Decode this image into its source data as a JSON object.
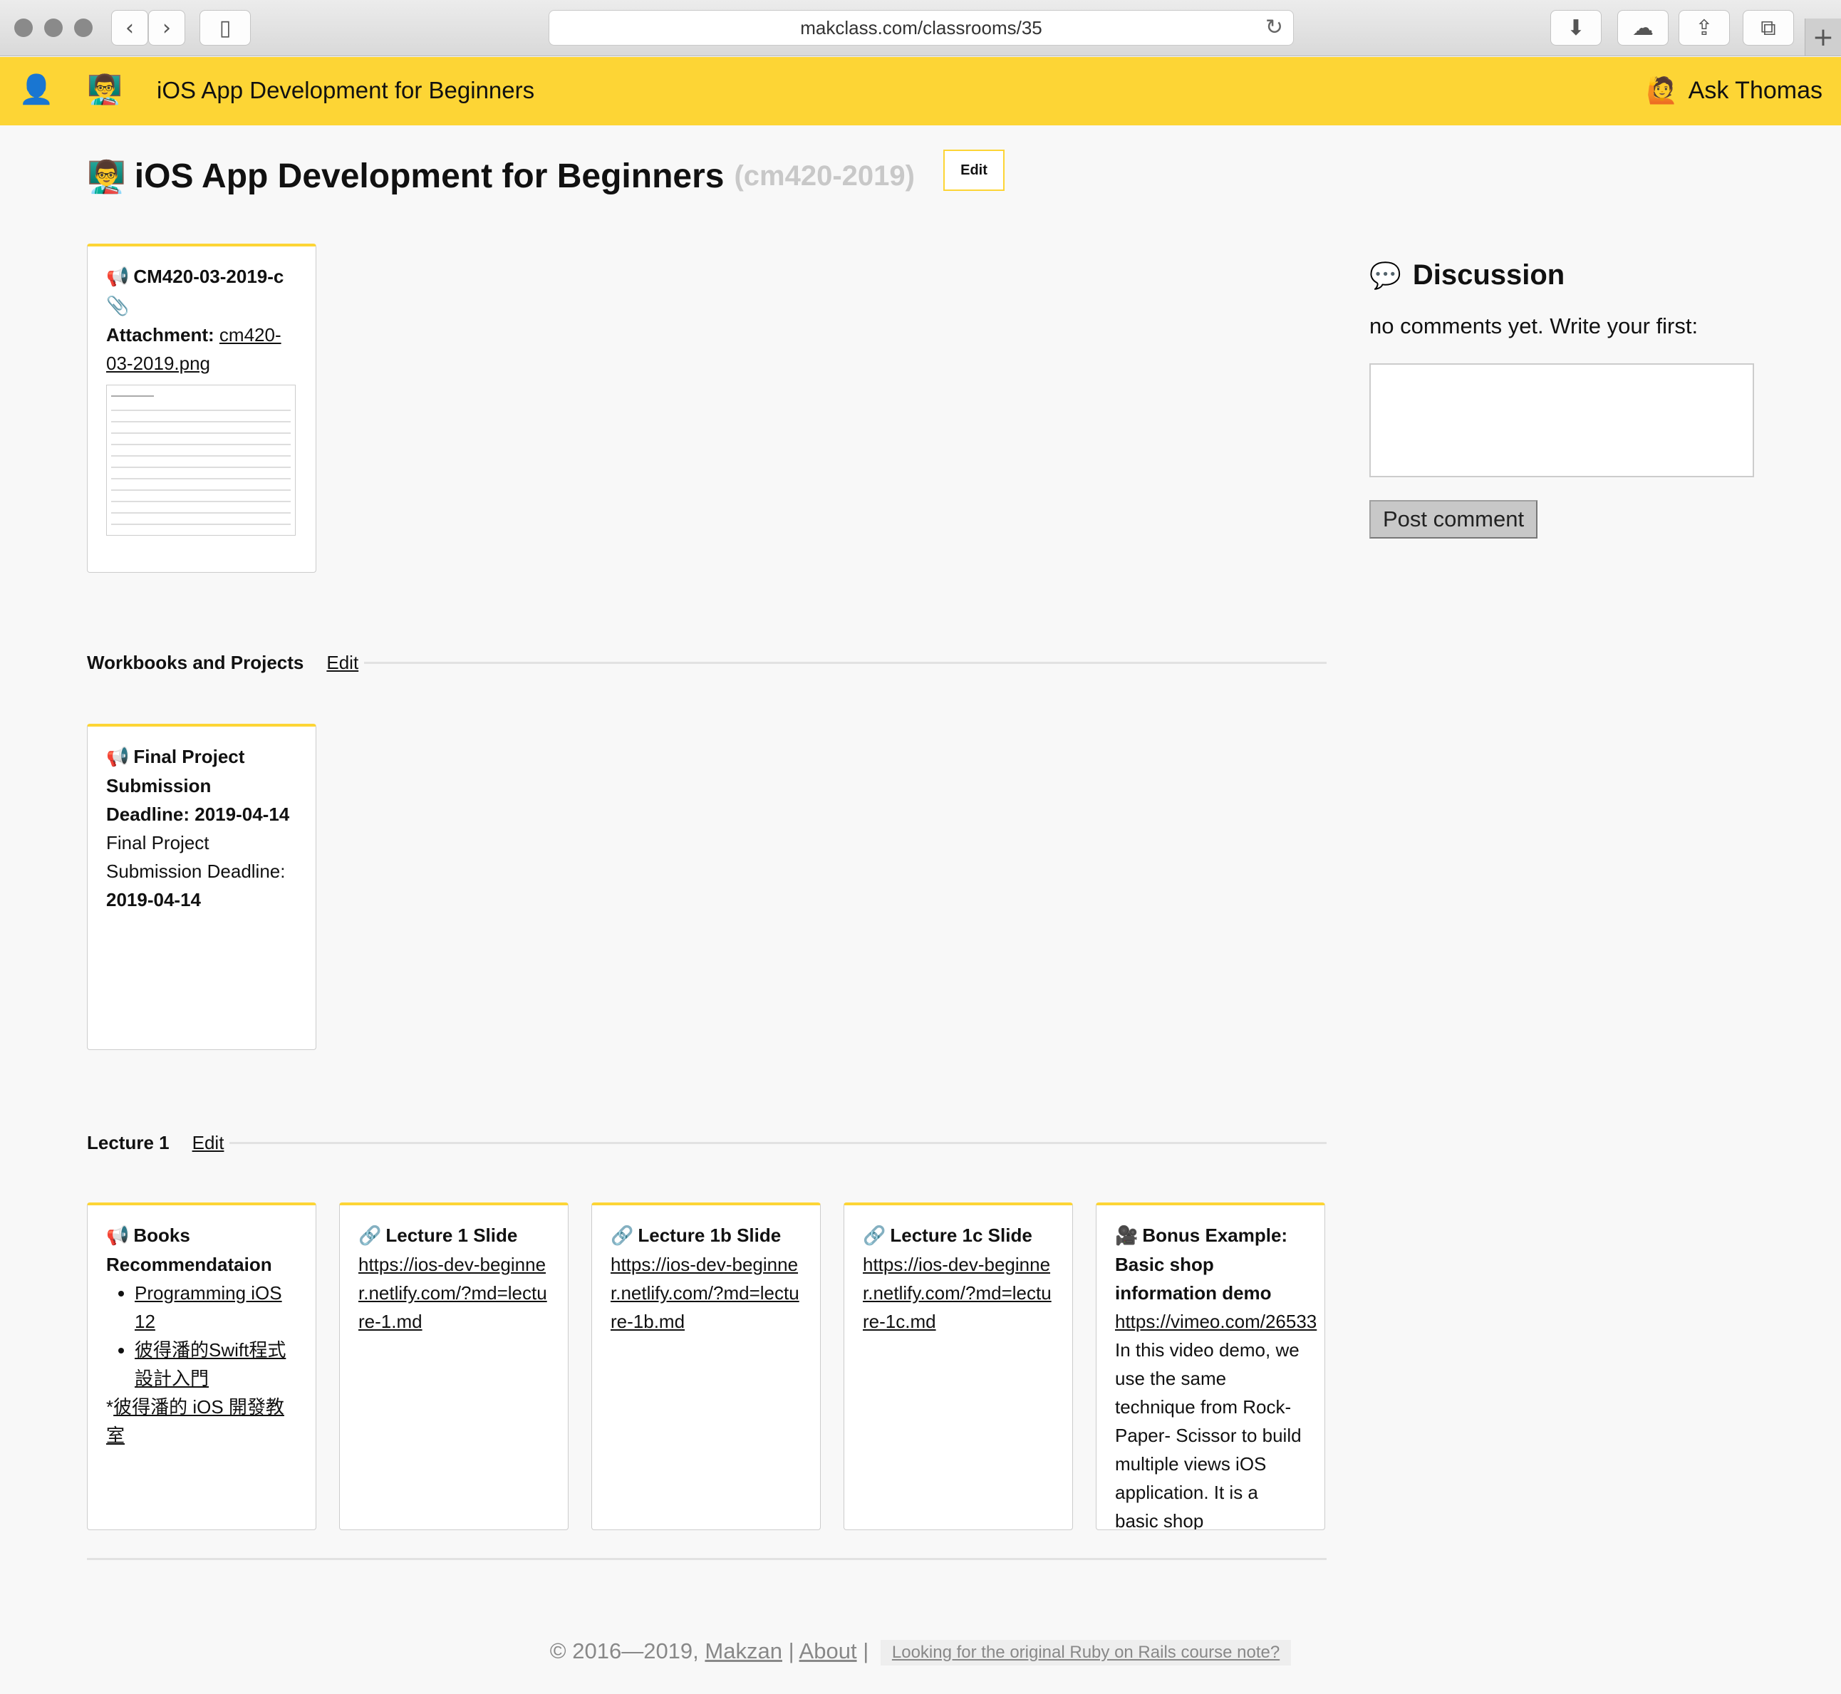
{
  "browser": {
    "url": "makclass.com/classrooms/35",
    "icons": [
      "traffic-lights",
      "back-icon",
      "forward-icon",
      "sidebar-icon",
      "reload-icon",
      "download-icon",
      "account-icon",
      "share-icon",
      "tabs-icon",
      "new-tab-icon"
    ]
  },
  "header": {
    "site_title": "iOS App Development for Beginners",
    "ask_label": "Ask Thomas",
    "brand_color": "#fdd535"
  },
  "page": {
    "title": "iOS App Development for Beginners",
    "code": "(cm420-2019)",
    "edit_label": "Edit"
  },
  "top_card": {
    "title": "CM420-03-2019-c",
    "attachment_label": "Attachment:",
    "attachment_link": "cm420-03-2019.png"
  },
  "sections": [
    {
      "name": "Workbooks and Projects",
      "edit": "Edit",
      "cards": [
        {
          "title": "Final Project Submission Deadline: 2019-04-14",
          "body": "Final Project Submission Deadline:",
          "body_bold": "2019-04-14"
        }
      ]
    },
    {
      "name": "Lecture 1",
      "edit": "Edit",
      "cards": [
        {
          "title": "Books Recommendataion",
          "items": [
            "Programming iOS 12",
            "彼得潘的Swift程式設計入門"
          ],
          "extra_prefix": "*",
          "extra_link": "彼得潘的 iOS 開發教室"
        },
        {
          "title": "Lecture 1 Slide",
          "link": "https://ios-dev-beginner.netlify.com/?md=lecture-1.md"
        },
        {
          "title": "Lecture 1b Slide",
          "link": "https://ios-dev-beginner.netlify.com/?md=lecture-1b.md"
        },
        {
          "title": "Lecture 1c Slide",
          "link": "https://ios-dev-beginner.netlify.com/?md=lecture-1c.md"
        },
        {
          "title": "Bonus Example: Basic shop information demo",
          "link": "https://vimeo.com/26533",
          "body": "In this video demo, we use the same technique from Rock-Paper- Scissor to build multiple views iOS application. It is a basic shop"
        }
      ]
    }
  ],
  "discussion": {
    "title": "Discussion",
    "empty_text": "no comments yet. Write your first:",
    "post_label": "Post comment"
  },
  "footer": {
    "copyright": "© 2016—2019,",
    "author": "Makzan",
    "sep": "|",
    "about": "About",
    "legacy": "Looking for the original Ruby on Rails course note?"
  }
}
